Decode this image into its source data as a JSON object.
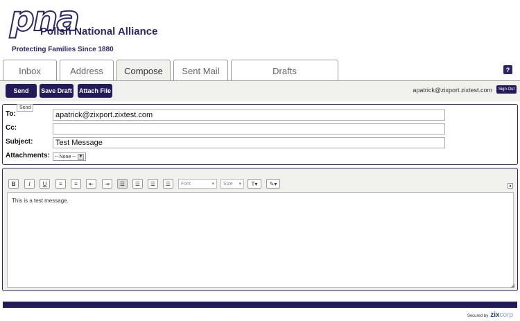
{
  "brand": {
    "logo_mark": "pna",
    "name": "Polish National Alliance",
    "tagline": "Protecting Families Since 1880"
  },
  "tabs": [
    {
      "label": "Inbox"
    },
    {
      "label": "Address"
    },
    {
      "label": "Compose",
      "active": true
    },
    {
      "label": "Sent Mail"
    },
    {
      "label": "Drafts"
    }
  ],
  "help": {
    "label": "?"
  },
  "toolbar": {
    "send_label": "Send",
    "save_draft_label": "Save Draft",
    "attach_file_label": "Attach File",
    "send_tooltip": "Send"
  },
  "user": {
    "email": "apatrick@zixport.zixtest.com",
    "sign_out_label": "Sign Out"
  },
  "fields": {
    "to_label": "To:",
    "to_value": "apatrick@zixport.zixtest.com",
    "cc_label": "Cc:",
    "cc_value": "",
    "subject_label": "Subject:",
    "subject_value": "Test Message",
    "attachments_label": "Attachments:",
    "attachments_value": "-- None --"
  },
  "editor": {
    "bold": "B",
    "italic": "I",
    "underline": "U",
    "font_placeholder": "Font",
    "size_placeholder": "Size",
    "body": "This is a test message."
  },
  "footer": {
    "secured_by": "Secured by",
    "zix": "zix",
    "corp": "corp"
  },
  "colors": {
    "brand_navy": "#231b59",
    "panel_bg": "#f0f0ec"
  }
}
